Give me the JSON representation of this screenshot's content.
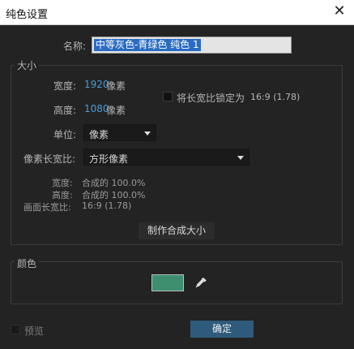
{
  "window": {
    "title": "纯色设置"
  },
  "name_field": {
    "label": "名称:",
    "value": "中等灰色-青绿色 纯色 1"
  },
  "size_group": {
    "legend": "大小",
    "width_label": "宽度:",
    "width_value": "1920",
    "width_unit": "像素",
    "height_label": "高度:",
    "height_value": "1080",
    "height_unit": "像素",
    "lock_label": "将长宽比锁定为",
    "lock_ratio": "16:9 (1.78)",
    "lock_checked": false,
    "unit_label": "单位:",
    "unit_value": "像素",
    "par_label": "像素长宽比:",
    "par_value": "方形像素",
    "info": {
      "width_label": "宽度:",
      "width_value": "合成的 100.0%",
      "height_label": "高度:",
      "height_value": "合成的 100.0%",
      "frame_label": "画面长宽比:",
      "frame_value": "16:9 (1.78)"
    },
    "make_comp_size_button": "制作合成大小"
  },
  "color_group": {
    "legend": "颜色",
    "swatch_color": "#3d8f70"
  },
  "footer": {
    "preview_label": "预览",
    "preview_checked": false,
    "ok_button": "确定"
  },
  "colors": {
    "accent_blue": "#4a9bd6",
    "ok_button": "#2e5b7c",
    "background": "#232323"
  }
}
